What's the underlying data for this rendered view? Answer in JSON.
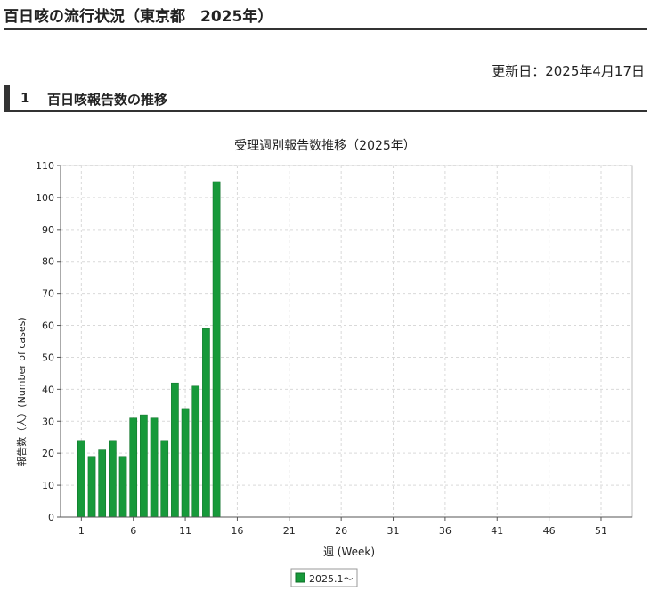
{
  "page": {
    "title": "百日咳の流行状況（東京都　2025年）",
    "updated": "更新日：2025年4月17日",
    "section_number": "1",
    "section_title": "百日咳報告数の推移"
  },
  "colors": {
    "bar": "#17993a",
    "bar_edge": "#0b6e26",
    "grid": "#d9d9d9",
    "axis": "#555555"
  },
  "chart_data": {
    "type": "bar",
    "title": "受理週別報告数推移（2025年）",
    "xlabel": "週 (Week)",
    "ylabel": "報告数（人）(Number of cases)",
    "ylim": [
      0,
      110
    ],
    "xlim": [
      -1,
      54
    ],
    "yticks": [
      0,
      10,
      20,
      30,
      40,
      50,
      60,
      70,
      80,
      90,
      100,
      110
    ],
    "xticks": [
      1,
      6,
      11,
      16,
      21,
      26,
      31,
      36,
      41,
      46,
      51
    ],
    "grid": true,
    "legend_position": "bottom-center",
    "series": [
      {
        "name": "2025.1〜",
        "x": [
          1,
          2,
          3,
          4,
          5,
          6,
          7,
          8,
          9,
          10,
          11,
          12,
          13,
          14,
          15
        ],
        "values": [
          24,
          19,
          21,
          24,
          19,
          31,
          32,
          31,
          24,
          42,
          34,
          41,
          59,
          105,
          0
        ]
      }
    ]
  }
}
